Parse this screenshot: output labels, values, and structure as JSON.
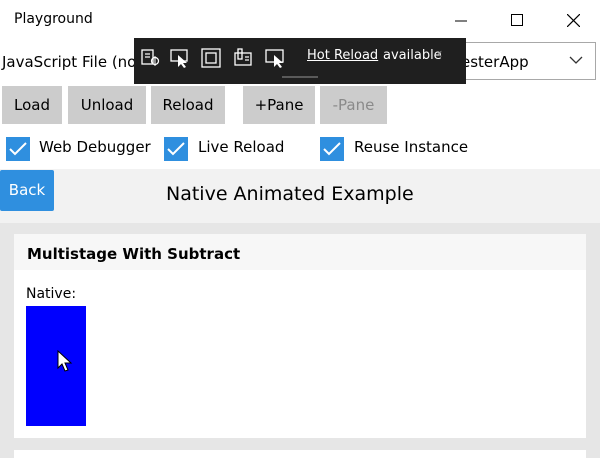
{
  "window": {
    "title": "Playground",
    "controls": {
      "minimize": "minimize-icon",
      "maximize": "maximize-icon",
      "close": "close-icon"
    }
  },
  "row1": {
    "label": "JavaScript File (no",
    "combo_value": "esterApp"
  },
  "debug_toolbar": {
    "icons": [
      "live-visual-tree-icon",
      "select-element-icon",
      "display-layout-adorners-icon",
      "track-focused-element-icon",
      "preview-selection-icon"
    ],
    "hot_reload_link": "Hot Reload",
    "hot_reload_status": "available",
    "collapse_glyph": "‹"
  },
  "buttons": {
    "load": "Load",
    "unload": "Unload",
    "reload": "Reload",
    "add_pane": "+Pane",
    "remove_pane": "-Pane"
  },
  "checkboxes": [
    {
      "label": "Web Debugger",
      "checked": true
    },
    {
      "label": "Live Reload",
      "checked": true
    },
    {
      "label": "Reuse Instance",
      "checked": true
    }
  ],
  "header": {
    "back": "Back",
    "title": "Native Animated Example"
  },
  "example": {
    "title": "Multistage With Subtract",
    "native_label": "Native:",
    "box_color": "#0000ff"
  },
  "colors": {
    "accent": "#2f8fdf",
    "button_bg": "#cccccc",
    "toolbar_bg": "#1f1f1f"
  }
}
